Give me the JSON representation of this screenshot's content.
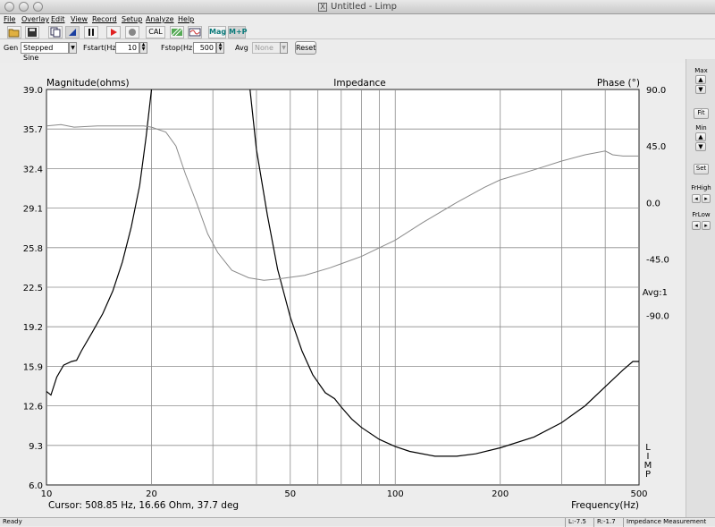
{
  "window": {
    "title": "Untitled - Limp"
  },
  "menu": [
    "File",
    "Overlay",
    "Edit",
    "View",
    "Record",
    "Setup",
    "Analyze",
    "Help"
  ],
  "toolbar": {
    "cal_label": "CAL",
    "mag_label": "Mag",
    "mp_label": "M+P"
  },
  "genbar": {
    "gen_label": "Gen",
    "gen_value": "Stepped Sine",
    "fstart_label": "Fstart(Hz",
    "fstart_value": "10",
    "fstop_label": "Fstop(Hz",
    "fstop_value": "500",
    "avg_label": "Avg",
    "avg_value": "None",
    "reset_label": "Reset"
  },
  "side": {
    "max_label": "Max",
    "fit_label": "Fit",
    "min_label": "Min",
    "set_label": "Set",
    "frhigh_label": "FrHigh",
    "frlow_label": "FrLow"
  },
  "status": {
    "ready": "Ready",
    "l": "L:-7.5",
    "r": "R:-1.7",
    "mode": "Impedance Measurement"
  },
  "chart_data": {
    "type": "line",
    "title": "Impedance",
    "ylabel": "Magnitude(ohms)",
    "y2label": "Phase (°)",
    "xlabel": "Frequency(Hz)",
    "xscale": "log",
    "xlim": [
      10,
      500
    ],
    "ylim": [
      6.0,
      39.0
    ],
    "y2lim": [
      -225,
      90
    ],
    "x_ticks": [
      "10",
      "20",
      "50",
      "100",
      "200",
      "500"
    ],
    "y_ticks": [
      "39.0",
      "35.7",
      "32.4",
      "29.1",
      "25.8",
      "22.5",
      "19.2",
      "15.9",
      "12.6",
      "9.3",
      "6.0"
    ],
    "y2_ticks": [
      "90.0",
      "45.0",
      "0.0",
      "-45.0",
      "-90.0"
    ],
    "avg_annotation": "Avg:1",
    "side_annotation": [
      "L",
      "I",
      "M",
      "P"
    ],
    "cursor_readout": "Cursor: 508.85 Hz, 16.66 Ohm, 37.7 deg",
    "grid": true,
    "colors": {
      "magnitude": "#000000",
      "phase": "#8a8a8a",
      "grid": "#8c8c8c"
    },
    "series": [
      {
        "role": "magnitude",
        "axis": "left",
        "x": [
          10,
          10.3,
          10.7,
          11.2,
          11.8,
          12.2,
          12.6,
          13.5,
          14.5,
          15.5,
          16.5,
          17.5,
          18.5,
          19.3,
          20.0,
          20.5,
          21.0,
          21.3,
          38,
          40,
          43,
          46,
          50,
          54,
          58,
          63,
          67,
          70,
          75,
          80,
          90,
          100,
          110,
          130,
          150,
          170,
          200,
          250,
          300,
          350,
          400,
          450,
          480,
          500
        ],
        "y": [
          13.8,
          13.5,
          15.0,
          16.0,
          16.3,
          16.4,
          17.2,
          18.7,
          20.3,
          22.2,
          24.6,
          27.5,
          31.0,
          35.0,
          39.0,
          41.0,
          43.0,
          44.0,
          40.0,
          34.0,
          28.5,
          24.0,
          20.0,
          17.2,
          15.2,
          13.7,
          13.2,
          12.5,
          11.5,
          10.8,
          9.8,
          9.2,
          8.8,
          8.4,
          8.4,
          8.6,
          9.1,
          10.0,
          11.2,
          12.6,
          14.2,
          15.6,
          16.3,
          16.3
        ]
      },
      {
        "role": "phase",
        "axis": "right",
        "x": [
          10,
          11,
          12,
          14,
          16,
          18,
          19,
          20,
          22,
          23.5,
          25,
          27,
          29,
          31,
          34,
          38,
          42,
          46,
          55,
          65,
          80,
          100,
          120,
          150,
          180,
          200,
          250,
          300,
          350,
          400,
          420,
          450,
          500
        ],
        "y": [
          61,
          62,
          60,
          61,
          61,
          61,
          61,
          60,
          56,
          45,
          23,
          -1,
          -25,
          -40,
          -54,
          -60,
          -62,
          -61,
          -58,
          -52,
          -43,
          -30,
          -16,
          0,
          12,
          18,
          26,
          33,
          38,
          41,
          38,
          37,
          37
        ]
      }
    ]
  }
}
